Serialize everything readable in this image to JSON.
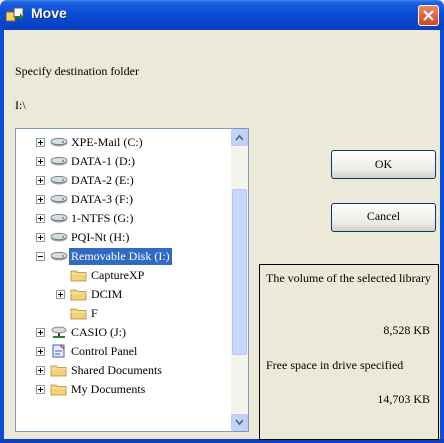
{
  "window": {
    "title": "Move"
  },
  "dialog": {
    "prompt": "Specify destination folder",
    "path": "I:\\"
  },
  "tree": {
    "items": [
      {
        "label": "XPE-Mail (C:)",
        "icon": "drive-icon",
        "expander": "plus"
      },
      {
        "label": "DATA-1 (D:)",
        "icon": "drive-icon",
        "expander": "plus"
      },
      {
        "label": "DATA-2 (E:)",
        "icon": "drive-icon",
        "expander": "plus"
      },
      {
        "label": "DATA-3 (F:)",
        "icon": "drive-icon",
        "expander": "plus"
      },
      {
        "label": "1-NTFS (G:)",
        "icon": "drive-icon",
        "expander": "plus"
      },
      {
        "label": "PQI-Nt (H:)",
        "icon": "drive-icon",
        "expander": "plus"
      },
      {
        "label": "Removable Disk (I:)",
        "icon": "drive-icon",
        "expander": "minus",
        "selected": true
      },
      {
        "label": "CaptureXP",
        "icon": "folder-icon",
        "expander": "none"
      },
      {
        "label": "DCIM",
        "icon": "folder-icon",
        "expander": "plus"
      },
      {
        "label": "F",
        "icon": "folder-icon",
        "expander": "none"
      },
      {
        "label": "CASIO (J:)",
        "icon": "network-drive-icon",
        "expander": "plus"
      },
      {
        "label": "Control Panel",
        "icon": "control-panel-icon",
        "expander": "plus"
      },
      {
        "label": "Shared Documents",
        "icon": "folder-icon",
        "expander": "plus"
      },
      {
        "label": "My Documents",
        "icon": "folder-icon",
        "expander": "plus"
      }
    ]
  },
  "buttons": {
    "ok": "OK",
    "cancel": "Cancel"
  },
  "info": {
    "volume_label": "The volume of the selected library",
    "volume_value": "8,528  KB",
    "free_label": "Free space in drive specified",
    "free_value": "14,703  KB"
  },
  "colors": {
    "title_bar": "#0a4fd7",
    "selection": "#316ac5",
    "dialog_bg": "#ece9d8"
  }
}
